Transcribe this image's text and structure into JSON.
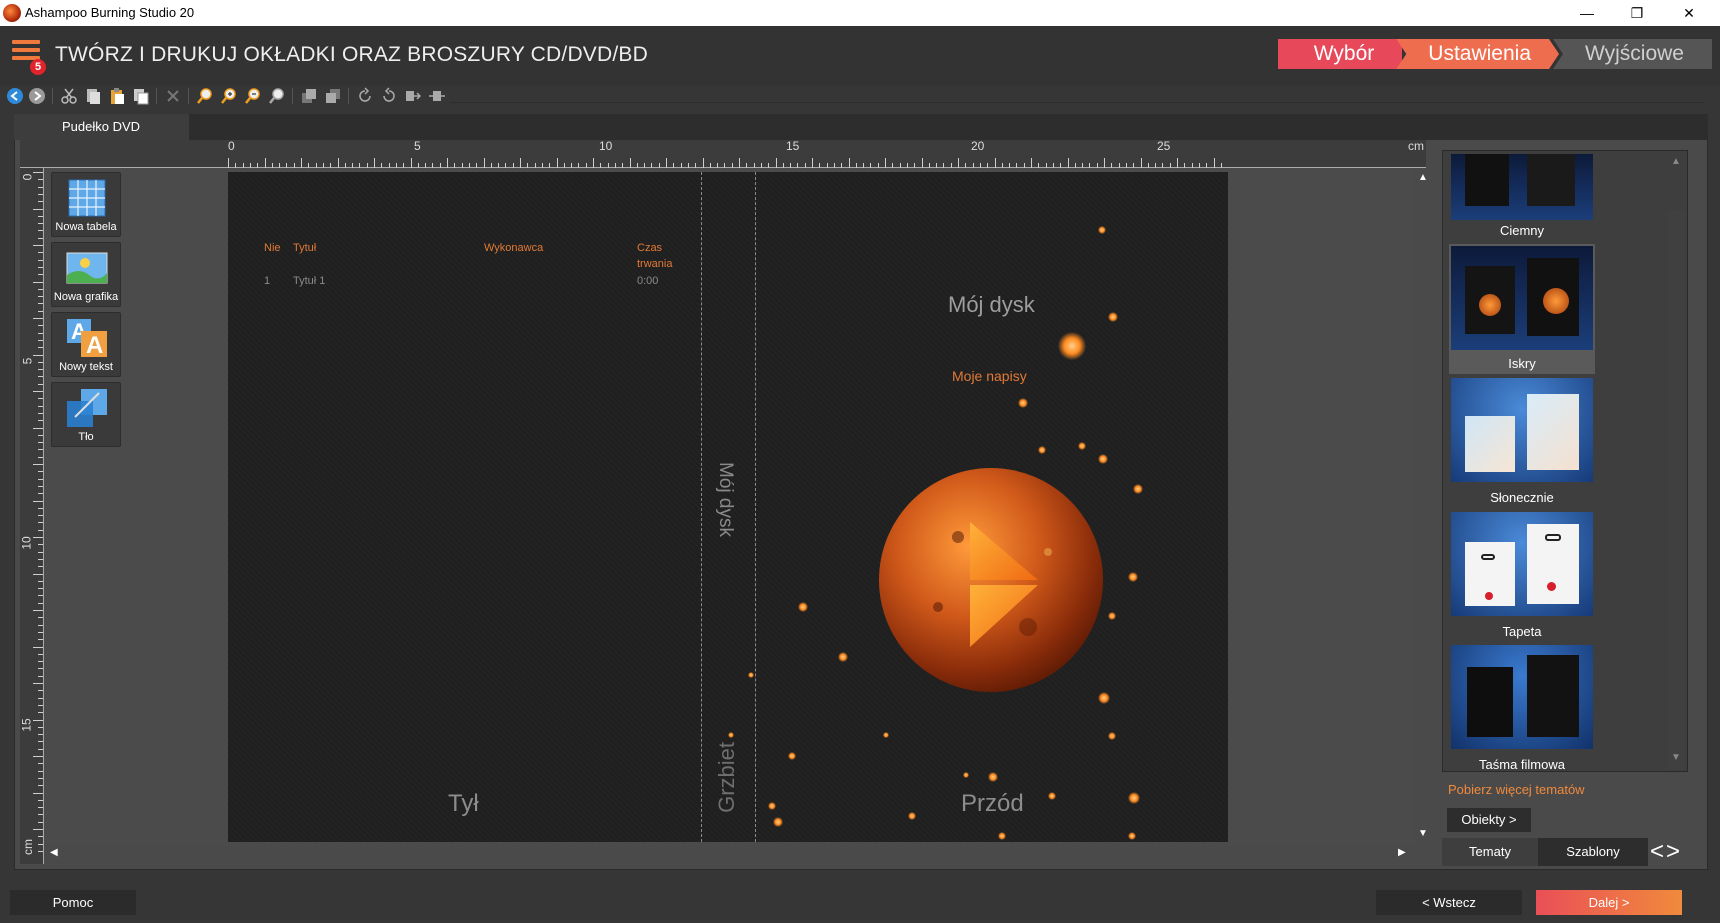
{
  "window": {
    "title": "Ashampoo Burning Studio 20",
    "minimize": "—",
    "restore": "❐",
    "close": "✕"
  },
  "header": {
    "menu_badge": "5",
    "title": "TWÓRZ I DRUKUJ OKŁADKI ORAZ BROSZURY CD/DVD/BD",
    "steps": [
      "Wybór",
      "Ustawienia",
      "Wyjściowe"
    ]
  },
  "toolbar": {
    "icons": [
      "back-icon",
      "forward-icon",
      "cut-icon",
      "copy-icon",
      "paste-icon",
      "duplicate-icon",
      "delete-icon",
      "zoom-fit-icon",
      "zoom-in-icon",
      "zoom-out-icon",
      "zoom-page-icon",
      "bring-front-icon",
      "send-back-icon",
      "rotate-left-icon",
      "rotate-right-icon",
      "align-icon",
      "distribute-icon"
    ]
  },
  "tab": {
    "label": "Pudełko DVD"
  },
  "ruler": {
    "top_numbers": [
      "0",
      "5",
      "10",
      "15",
      "20",
      "25"
    ],
    "top_unit": "cm",
    "left_numbers": [
      "0",
      "5",
      "10",
      "15"
    ],
    "left_unit": "cm"
  },
  "tools": [
    {
      "label": "Nowa tabela",
      "icon": "table-icon"
    },
    {
      "label": "Nowa grafika",
      "icon": "image-icon"
    },
    {
      "label": "Nowy tekst",
      "icon": "text-icon"
    },
    {
      "label": "Tło",
      "icon": "background-icon"
    }
  ],
  "cover": {
    "track_headers": {
      "num": "Nie",
      "title": "Tytuł",
      "artist": "Wykonawca",
      "duration_1": "Czas",
      "duration_2": "trwania"
    },
    "track_row": {
      "num": "1",
      "title": "Tytuł 1",
      "duration": "0:00"
    },
    "back_label": "Tył",
    "spine_label": "Grzbiet",
    "spine_title": "Mój dysk",
    "front_title": "Mój dysk",
    "front_subtitle": "Moje napisy",
    "front_label": "Przód"
  },
  "themes": [
    {
      "label": "Ciemny"
    },
    {
      "label": "Iskry",
      "selected": true
    },
    {
      "label": "Słonecznie"
    },
    {
      "label": "Tapeta"
    },
    {
      "label": "Taśma filmowa"
    }
  ],
  "panel": {
    "more_link": "Pobierz więcej tematów",
    "objects_button": "Obiekty >",
    "tab_themes": "Tematy",
    "tab_templates": "Szablony",
    "nav_arrows": "<>"
  },
  "footer": {
    "help": "Pomoc",
    "back": "< Wstecz",
    "next": "Dalej >"
  },
  "colors": {
    "accent_orange": "#f08a3c",
    "accent_red": "#e8495a",
    "step_active": "#ef6d4f"
  }
}
